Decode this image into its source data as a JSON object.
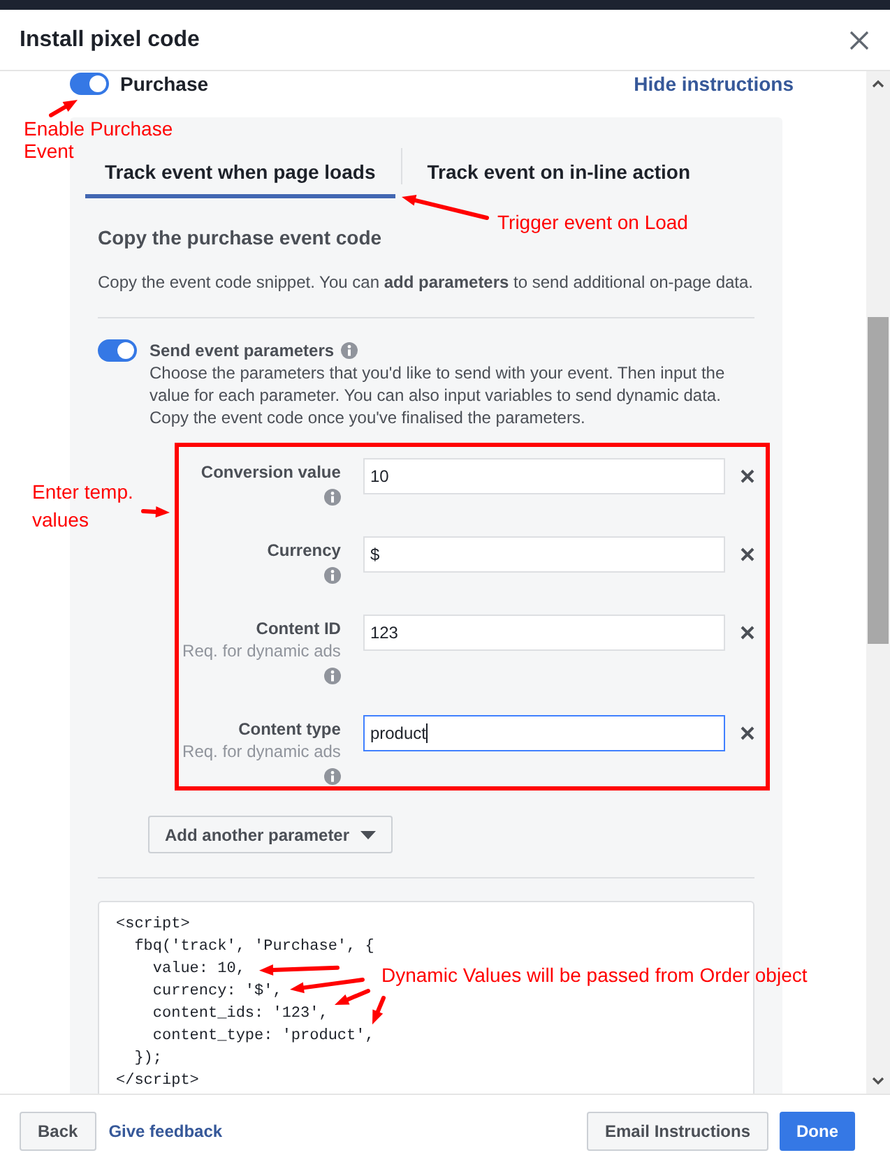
{
  "window": {
    "title": "Install pixel code"
  },
  "event_toggle": {
    "label": "Purchase",
    "on": true
  },
  "hide_instructions_link": "Hide instructions",
  "tabs": [
    {
      "label": "Track event when page loads",
      "selected": true
    },
    {
      "label": "Track event on in-line action",
      "selected": false
    }
  ],
  "section": {
    "heading": "Copy the purchase event code",
    "description": "Copy the event code snippet. You can **add parameters** to send additional on-page data."
  },
  "parameters_toggle": {
    "label": "Send event parameters",
    "on": true,
    "description": "Choose the parameters that you'd like to send with your event. Then input the value for each parameter. You can also input variables to send dynamic data. Copy the event code once you've finalised the parameters."
  },
  "parameters": [
    {
      "label": "Conversion value",
      "value": "10",
      "focused": false
    },
    {
      "label": "Currency",
      "value": "$",
      "focused": false
    },
    {
      "label": "Content ID",
      "hint": "Req. for dynamic ads",
      "value": "123",
      "focused": false
    },
    {
      "label": "Content type",
      "hint": "Req. for dynamic ads",
      "value": "product",
      "focused": true
    }
  ],
  "add_parameter_button": {
    "label": "Add another parameter"
  },
  "code_lines": [
    "<script>",
    "  fbq('track', 'Purchase', {",
    "    value: 10,",
    "    currency: '$',",
    "    content_ids: '123',",
    "    content_type: 'product',",
    "  });",
    "</script>"
  ],
  "footer": {
    "left_buttons": [
      {
        "label": "Back",
        "kind": "secondary"
      },
      {
        "label": "Give feedback",
        "kind": "link"
      }
    ],
    "right_buttons": [
      {
        "label": "Email Instructions",
        "kind": "secondary"
      },
      {
        "label": "Done",
        "kind": "primary"
      }
    ]
  },
  "annotations": [
    {
      "text": "Enable Purchase Event"
    },
    {
      "text": "Trigger event on Load"
    },
    {
      "text": "Enter temp. values"
    },
    {
      "text": "Dynamic Values will be passed from Order object"
    }
  ]
}
